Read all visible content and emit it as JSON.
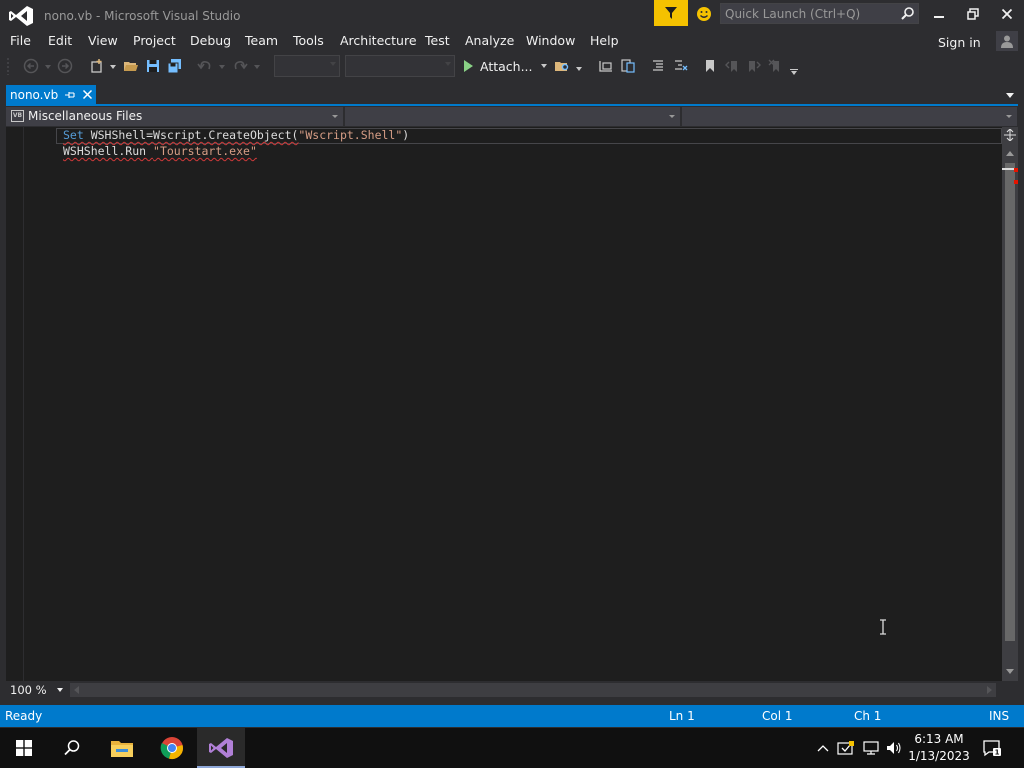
{
  "window": {
    "title": "nono.vb - Microsoft Visual Studio",
    "quick_launch_placeholder": "Quick Launch (Ctrl+Q)"
  },
  "menu": {
    "items": [
      "File",
      "Edit",
      "View",
      "Project",
      "Debug",
      "Team",
      "Tools",
      "Architecture",
      "Test",
      "Analyze",
      "Window",
      "Help"
    ],
    "sign_in": "Sign in"
  },
  "toolbar": {
    "attach_label": "Attach..."
  },
  "tabs": {
    "active": "nono.vb"
  },
  "navbar": {
    "project": "Miscellaneous Files",
    "file_type_icon": "VB"
  },
  "editor": {
    "lines": [
      {
        "keyword": "Set",
        "rest": " WSHShell=Wscript.CreateObject(",
        "string": "\"Wscript.Shell\"",
        "tail": ")"
      },
      {
        "keyword": "",
        "rest": "WSHShell.Run ",
        "string": "\"Tourstart.exe\"",
        "tail": ""
      }
    ],
    "zoom": "100 %"
  },
  "statusbar": {
    "state": "Ready",
    "line": "Ln 1",
    "col": "Col 1",
    "ch": "Ch 1",
    "mode": "INS"
  },
  "taskbar": {
    "time": "6:13 AM",
    "date": "1/13/2023"
  },
  "colors": {
    "accent": "#007acc",
    "background": "#2d2d30",
    "editor_bg": "#1e1e1e",
    "keyword": "#569cd6",
    "string": "#d69d85",
    "notification": "#f5c200"
  }
}
